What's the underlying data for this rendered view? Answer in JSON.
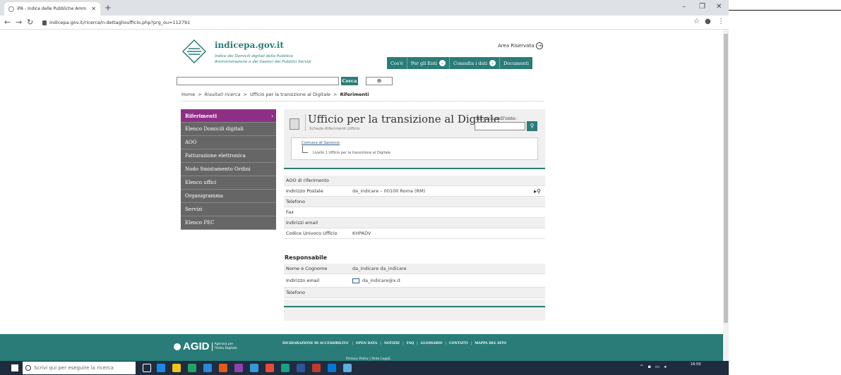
{
  "browser": {
    "tab_title": "iPA - Indice delle Pubbliche Amm",
    "url": "indicepa.gov.it/ricerca/n-dettaglioufficio.php?prg_ou=112791"
  },
  "header": {
    "site_name": "indicepa.gov.it",
    "subtitle_line1": "Indice dei Domicili digitali della Pubblica",
    "subtitle_line2": "Amministrazione e dei Gestori dei Pubblici Servizi",
    "area_riservata": "Area Riservata",
    "nav": [
      {
        "label": "Cos'è",
        "dropdown": false
      },
      {
        "label": "Per gli Enti",
        "dropdown": true
      },
      {
        "label": "Consulta i dati",
        "dropdown": true
      },
      {
        "label": "Documenti",
        "dropdown": false
      }
    ]
  },
  "search": {
    "button_label": "Cerca",
    "value": ""
  },
  "breadcrumb": {
    "home": "Home",
    "sep": ">",
    "results": "Risultati ricerca",
    "office": "Ufficio per la transizione al Digitale",
    "current": "Riferimenti"
  },
  "sidebar": {
    "items": [
      {
        "label": "Riferimenti",
        "active": true
      },
      {
        "label": "Elenco Domicili digitali"
      },
      {
        "label": "AOO"
      },
      {
        "label": "Fatturazione elettronica"
      },
      {
        "label": "Nodo Smistamento Ordini"
      },
      {
        "label": "Elenco uffici"
      },
      {
        "label": "Organigramma"
      },
      {
        "label": "Servizi"
      },
      {
        "label": "Elenco PEC"
      }
    ]
  },
  "office": {
    "title": "Ufficio per la transizione al Digitale",
    "subtitle": "Scheda Riferimenti Ufficio",
    "entity_search_label": "Ricerca nell'ente:",
    "hierarchy_root": "Comune di Saronno",
    "hierarchy_child": "Livello 1 Ufficio per la transizione al Digitale"
  },
  "details": {
    "rows": [
      {
        "label": "AOO di riferimento",
        "value": ""
      },
      {
        "label": "Indirizzo Postale",
        "value": "da_indicare – 00100 Roma (RM)"
      },
      {
        "label": "Telefono",
        "value": ""
      },
      {
        "label": "Fax",
        "value": ""
      },
      {
        "label": "Indirizzi email",
        "value": ""
      },
      {
        "label": "Codice Univoco Ufficio",
        "value": "KHPADV"
      }
    ]
  },
  "responsabile": {
    "title": "Responsabile",
    "rows": [
      {
        "label": "Nome e Cognome",
        "value": "da_indicare da_indicare"
      },
      {
        "label": "Indirizzo email",
        "value": "da_indicare@x.it"
      },
      {
        "label": "Telefono",
        "value": ""
      }
    ]
  },
  "footer": {
    "logo_word": "AGID",
    "logo_tag1": "Agenzia per",
    "logo_tag2": "l'Italia Digitale",
    "links": [
      "DICHIARAZIONE DI ACCESSIBILITA'",
      "OPEN DATA",
      "NOTIZIE",
      "FAQ",
      "GLOSSARIO",
      "CONTATTI",
      "MAPPA DEL SITO"
    ],
    "bottom": "Privacy Policy | Note Legali"
  },
  "taskbar": {
    "search_placeholder": "Scrivi qui per eseguire la ricerca",
    "time": "16:59"
  },
  "colors": {
    "teal": "#2a7c78",
    "purple_active": "#8e2f86",
    "sidebar_grey": "#666666"
  }
}
